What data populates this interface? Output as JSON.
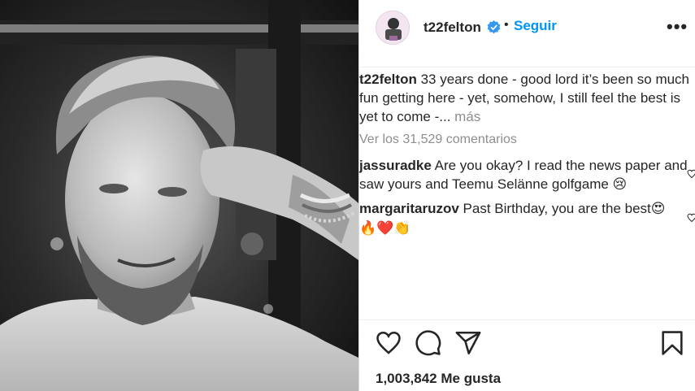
{
  "post": {
    "username": "t22felton",
    "follow_label": "Seguir",
    "separator": "•",
    "more_icon_text": "•••",
    "caption_user": "t22felton",
    "caption_text": " 33 years done - good lord it’s been so much fun getting here - yet, somehow, I still feel the best is yet to come -",
    "caption_ellipsis": "... ",
    "caption_more": "más",
    "view_comments": "Ver los 31,529 comentarios",
    "likes": "1,003,842 Me gusta"
  },
  "comments": [
    {
      "user": "jassuradke",
      "text": " Are you okay? I read the news paper and saw yours and Teemu Selänne golfgame ",
      "emoji": "😢"
    },
    {
      "user": "margaritaruzov",
      "text": " Past Birthday, you are the best",
      "emoji": "😍",
      "emoji_line2": "🔥❤️👏"
    }
  ],
  "icons": {
    "header": [
      "verified-badge-icon",
      "more-options-icon"
    ],
    "actions": [
      "heart-icon",
      "comment-icon",
      "share-icon",
      "bookmark-icon"
    ]
  },
  "colors": {
    "link_blue": "#0095f6",
    "verified_blue": "#3897f0",
    "text": "#262626",
    "muted": "#8e8e8e"
  }
}
